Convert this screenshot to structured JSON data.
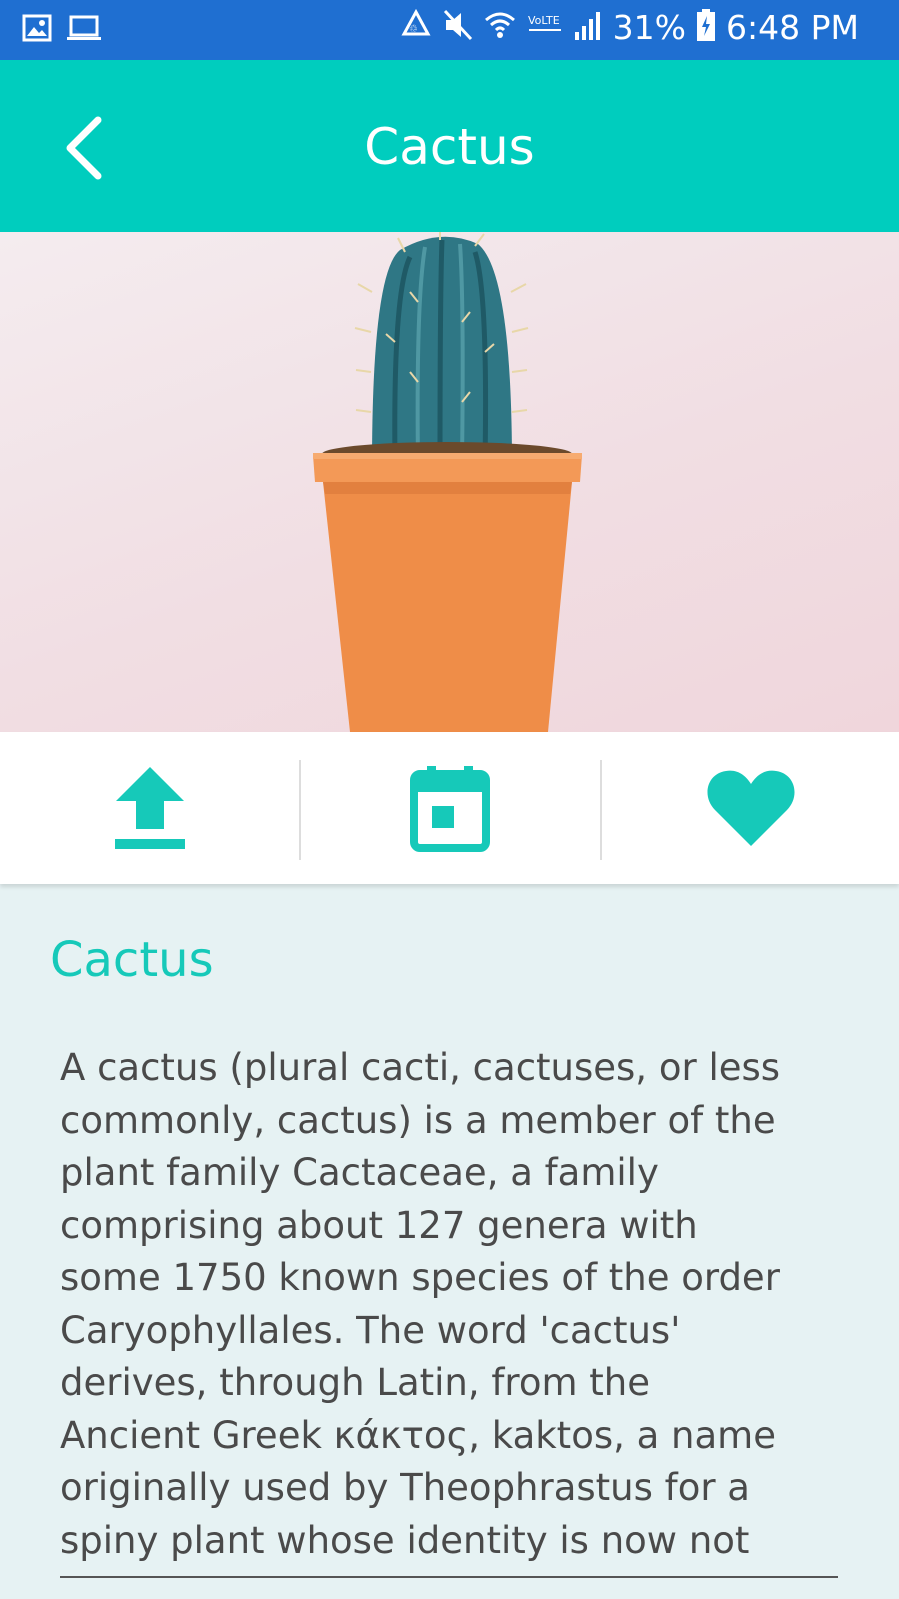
{
  "status_bar": {
    "battery": "31%",
    "time": "6:48 PM",
    "icons": [
      "image-icon",
      "laptop-icon",
      "recycle-icon",
      "mute-icon",
      "wifi-icon",
      "volte-icon",
      "signal-icon",
      "battery-icon"
    ]
  },
  "app_bar": {
    "title": "Cactus",
    "back_icon": "chevron-left-icon"
  },
  "actions": [
    {
      "name": "upload",
      "icon": "upload-icon"
    },
    {
      "name": "calendar",
      "icon": "calendar-icon"
    },
    {
      "name": "favorite",
      "icon": "heart-icon"
    }
  ],
  "content": {
    "title": "Cactus",
    "lines": [
      "A cactus (plural cacti, cactuses, or less",
      "commonly, cactus) is a member of the",
      "plant family Cactaceae, a family",
      "comprising about 127 genera with",
      "some 1750 known species of the order",
      "Caryophyllales. The word 'cactus'",
      "derives, through Latin, from the",
      "Ancient Greek κάκτος, kaktos, a name",
      "originally used by Theophrastus for a",
      "spiny plant whose identity is now not"
    ]
  },
  "colors": {
    "status_bar": "#1f6fd1",
    "accent": "#00cdbe",
    "background": "#e6f2f3",
    "pot": "#ef8d48"
  }
}
